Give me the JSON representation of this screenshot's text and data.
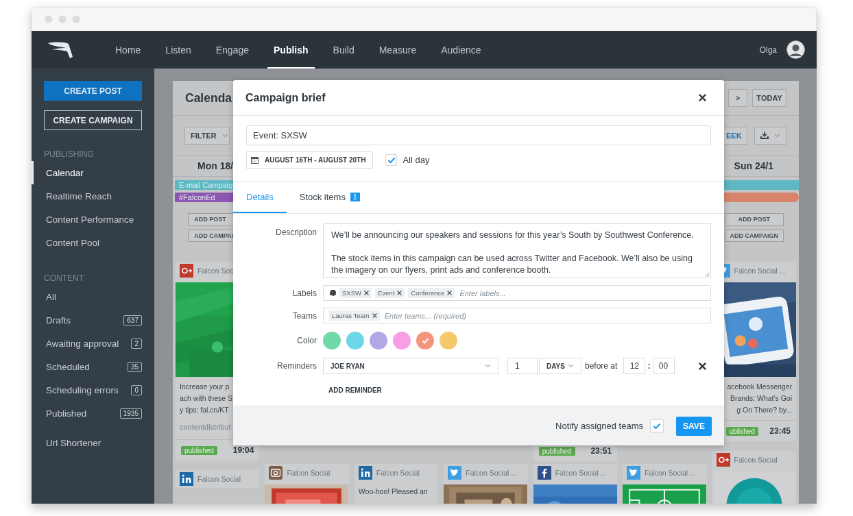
{
  "nav": {
    "items": [
      {
        "label": "Home",
        "selected": false
      },
      {
        "label": "Listen",
        "selected": false
      },
      {
        "label": "Engage",
        "selected": false
      },
      {
        "label": "Publish",
        "selected": true
      },
      {
        "label": "Build",
        "selected": false
      },
      {
        "label": "Measure",
        "selected": false
      },
      {
        "label": "Audience",
        "selected": false
      }
    ],
    "user": {
      "name": "Olga"
    }
  },
  "sidebar": {
    "buttons": [
      {
        "label": "CREATE POST",
        "kind": "primary"
      },
      {
        "label": "CREATE CAMPAIGN",
        "kind": "outline"
      }
    ],
    "sections": [
      {
        "heading": "PUBLISHING",
        "items": [
          {
            "label": "Calendar",
            "selected": true
          },
          {
            "label": "Realtime Reach",
            "selected": false
          },
          {
            "label": "Content Performance",
            "selected": false
          },
          {
            "label": "Content Pool",
            "selected": false
          }
        ]
      },
      {
        "heading": "CONTENT",
        "items": [
          {
            "label": "All",
            "selected": false
          },
          {
            "label": "Drafts",
            "count": "637",
            "selected": false
          },
          {
            "label": "Awaiting approval",
            "count": "2",
            "selected": false
          },
          {
            "label": "Scheduled",
            "count": "35",
            "selected": false
          },
          {
            "label": "Scheduling errors",
            "count": "0",
            "selected": false
          },
          {
            "label": "Published",
            "count": "1935",
            "selected": false
          }
        ]
      },
      {
        "items": [
          {
            "label": "Url Shortener",
            "selected": false
          }
        ]
      }
    ]
  },
  "calendar": {
    "title": "Calenda",
    "next": ">",
    "today": "TODAY",
    "filter": "FILTER",
    "view": "EEK",
    "campaigns": [
      [
        {
          "label": "E-mail Campaig",
          "color": "#5eb8c3"
        }
      ],
      [
        {
          "label": "#FalconEd",
          "color": "#8b57b1"
        },
        {
          "color": "#d8836b"
        }
      ]
    ],
    "columns": [
      {
        "day": "Mon 18/",
        "add": [
          "ADD POST",
          "ADD CAMPAI"
        ],
        "cards": [
          {
            "kind": "post",
            "source": {
              "kind": "gplus"
            },
            "author": "Falcon Soc",
            "text": "Increase your p\nach with these S\ny tips: fal.cn/KT",
            "link": "contentdistribut",
            "status": "published",
            "time": "19:04"
          },
          {
            "kind": "post",
            "source": {
              "kind": "linkedin"
            },
            "author": "Falcon Social"
          }
        ]
      },
      {
        "cards": [
          {
            "kind": "post",
            "source": {
              "kind": "camera"
            },
            "author": "Falcon Social"
          }
        ]
      },
      {
        "cards": [
          {
            "kind": "post",
            "source": {
              "kind": "linkedin"
            },
            "author": "Falcon Social",
            "text": "Woo-hoo! Pleased an"
          }
        ]
      },
      {
        "cards": [
          {
            "kind": "post",
            "source": {
              "kind": "twitter"
            },
            "author": "Falcon Social ..."
          }
        ]
      },
      {
        "cards": [
          {
            "kind": "footer",
            "status": "published",
            "time": "23:51"
          },
          {
            "kind": "post",
            "source": {
              "kind": "facebook"
            },
            "author": "Falcon Social ..."
          }
        ]
      },
      {
        "cards": [
          {
            "kind": "post",
            "source": {
              "kind": "twitter"
            },
            "author": "Falcon Social ..."
          }
        ]
      },
      {
        "day": "Sun 24/1",
        "add": [
          "ADD POST",
          "ADD CAMPAIGN"
        ],
        "cards": [
          {
            "kind": "post",
            "source": {
              "kind": "twitter"
            },
            "author": "Falcon Social ...",
            "text": "acebook Messenger\nBrands: What's Goi\ng On There? by...",
            "status": "ublished",
            "time": "23:45"
          },
          {
            "kind": "post",
            "source": {
              "kind": "gplus"
            },
            "author": "Falcon Social"
          }
        ]
      }
    ]
  },
  "modal": {
    "title": "Campaign brief",
    "name": {
      "value": "Event: SXSW"
    },
    "dates": "AUGUST 16TH - AUGUST 20TH",
    "all_day": {
      "label": "All day",
      "checked": true
    },
    "tabs": [
      {
        "label": "Details",
        "selected": true
      },
      {
        "label": "Stock items",
        "badge": "1",
        "selected": false
      }
    ],
    "description": {
      "label": "Description",
      "value": "We’ll be announcing our speakers and sessions for this year’s South by Southwest Conference.\n\nThe stock items in this campaign can be used across Twitter and Facebook. We’ll also be using the imagery on our flyers, print ads and conference booth."
    },
    "labels": {
      "label": "Labels",
      "chips": [
        "SXSW",
        "Event",
        "Conference"
      ],
      "placeholder": "Enter labels..."
    },
    "teams": {
      "label": "Teams",
      "chips": [
        "Lauras Team"
      ],
      "placeholder": "Enter teams... (required)"
    },
    "color": {
      "label": "Color",
      "options": [
        {
          "color": "#6fd9a8",
          "selected": false
        },
        {
          "color": "#6cd7e6",
          "selected": false
        },
        {
          "color": "#b4a7e6",
          "selected": false
        },
        {
          "color": "#f89ee6",
          "selected": false
        },
        {
          "color": "#f2957a",
          "selected": true
        },
        {
          "color": "#f5c96b",
          "selected": false
        }
      ]
    },
    "reminders": {
      "label": "Reminders",
      "items": [
        {
          "person": "JOE RYAN",
          "amount": "1",
          "unit": "DAYS",
          "text": "before at",
          "hour": "12",
          "separator": ":",
          "minute": "00"
        }
      ],
      "add": "ADD REMINDER"
    },
    "footer": {
      "notify": {
        "label": "Notify assigned teams",
        "checked": true
      },
      "save": "SAVE"
    }
  }
}
